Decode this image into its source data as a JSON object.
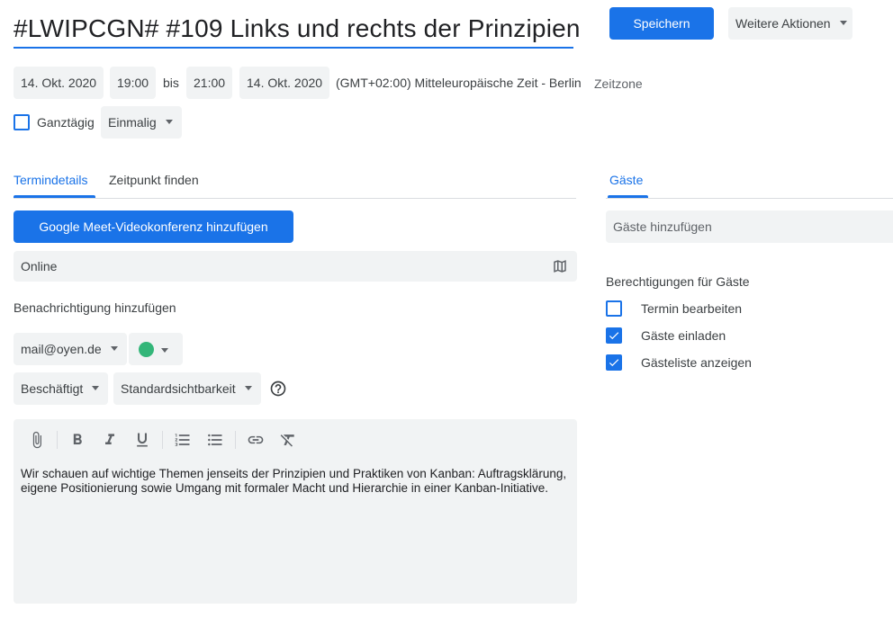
{
  "event": {
    "title": "#LWIPCGN# #109 Links und rechts der Prinzipien",
    "start_date": "14. Okt. 2020",
    "start_time": "19:00",
    "to_label": "bis",
    "end_time": "21:00",
    "end_date": "14. Okt. 2020",
    "timezone": "(GMT+02:00) Mitteleuropäische Zeit - Berlin",
    "timezone_button": "Zeitzone",
    "all_day_label": "Ganztägig",
    "recurrence": "Einmalig"
  },
  "actions": {
    "save": "Speichern",
    "more": "Weitere Aktionen"
  },
  "tabs": {
    "details": "Termindetails",
    "find_time": "Zeitpunkt finden",
    "guests": "Gäste"
  },
  "details": {
    "meet_button": "Google Meet-Videokonferenz hinzufügen",
    "location": "Online",
    "add_notification": "Benachrichtigung hinzufügen",
    "calendar": "mail@oyen.de",
    "calendar_color": "#33b679",
    "availability": "Beschäftigt",
    "visibility": "Standardsichtbarkeit",
    "description": "Wir schauen auf wichtige Themen jenseits der Prinzipien und Praktiken von Kanban: Auftragsklärung, eigene Positionierung sowie Umgang mit formaler Macht und Hierarchie in einer Kanban-Initiative."
  },
  "guests": {
    "add_placeholder": "Gäste hinzufügen",
    "permissions_title": "Berechtigungen für Gäste",
    "permissions": [
      {
        "label": "Termin bearbeiten",
        "checked": false
      },
      {
        "label": "Gäste einladen",
        "checked": true
      },
      {
        "label": "Gästeliste anzeigen",
        "checked": true
      }
    ]
  },
  "colors": {
    "accent": "#1a73e8",
    "chip_bg": "#f1f3f4"
  }
}
